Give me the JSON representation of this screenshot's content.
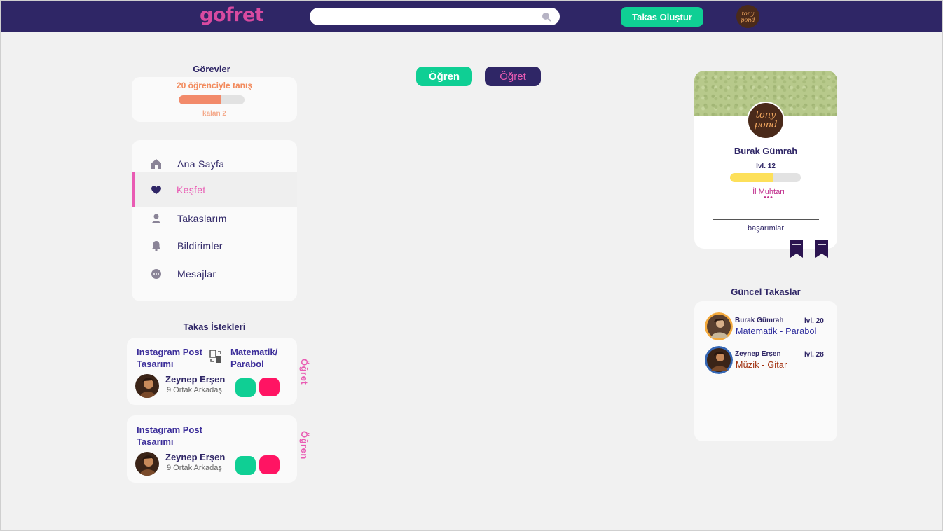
{
  "header": {
    "logo": "gofret",
    "search_placeholder": "",
    "create_button": "Takas Oluştur",
    "avatar_text": "tony pond"
  },
  "tasks": {
    "title": "Görevler",
    "task_name": "20 öğrenciyle tanış",
    "progress": 0.64,
    "remaining": "kalan 2"
  },
  "nav": {
    "items": [
      {
        "label": "Ana Sayfa",
        "icon": "home-icon"
      },
      {
        "label": "Keşfet",
        "icon": "heart-icon",
        "active": true
      },
      {
        "label": "Takaslarım",
        "icon": "user-icon"
      },
      {
        "label": "Bildirimler",
        "icon": "bell-icon"
      },
      {
        "label": "Mesajlar",
        "icon": "chat-icon"
      }
    ]
  },
  "requests": {
    "title": "Takas İstekleri",
    "items": [
      {
        "title": "Instagram Post Tasarımı",
        "skill": "Matematik/ Parabol",
        "name": "Zeynep Erşen",
        "mutual": "9 Ortak Arkadaş",
        "side": "Öğret"
      },
      {
        "title": "Instagram Post Tasarımı",
        "skill": "",
        "name": "Zeynep Erşen",
        "mutual": "9 Ortak Arkadaş",
        "side": "Öğren"
      }
    ]
  },
  "tabs": {
    "learn": "Öğren",
    "teach": "Öğret"
  },
  "profile": {
    "avatar_text": "tony pond",
    "name": "Burak Gümrah",
    "level": "lvl. 12",
    "progress": 0.6,
    "rank": "İl Muhtarı",
    "dots": "•••",
    "achievements": "başarımlar"
  },
  "current": {
    "title": "Güncel Takaslar",
    "items": [
      {
        "name": "Burak Gümrah",
        "level": "lvl. 20",
        "skill": "Matematik - Parabol",
        "skill_color": "#2b2a9c",
        "ring": "#f3a93c"
      },
      {
        "name": "Zeynep Erşen",
        "level": "lvl. 28",
        "skill": "Müzik - Gitar",
        "skill_color": "#a1300e",
        "ring": "#3466b4"
      }
    ]
  },
  "colors": {
    "brand": "#2f2666",
    "accent_green": "#0fcf94",
    "accent_pink": "#e95bb3",
    "reject_red": "#ff1463"
  }
}
